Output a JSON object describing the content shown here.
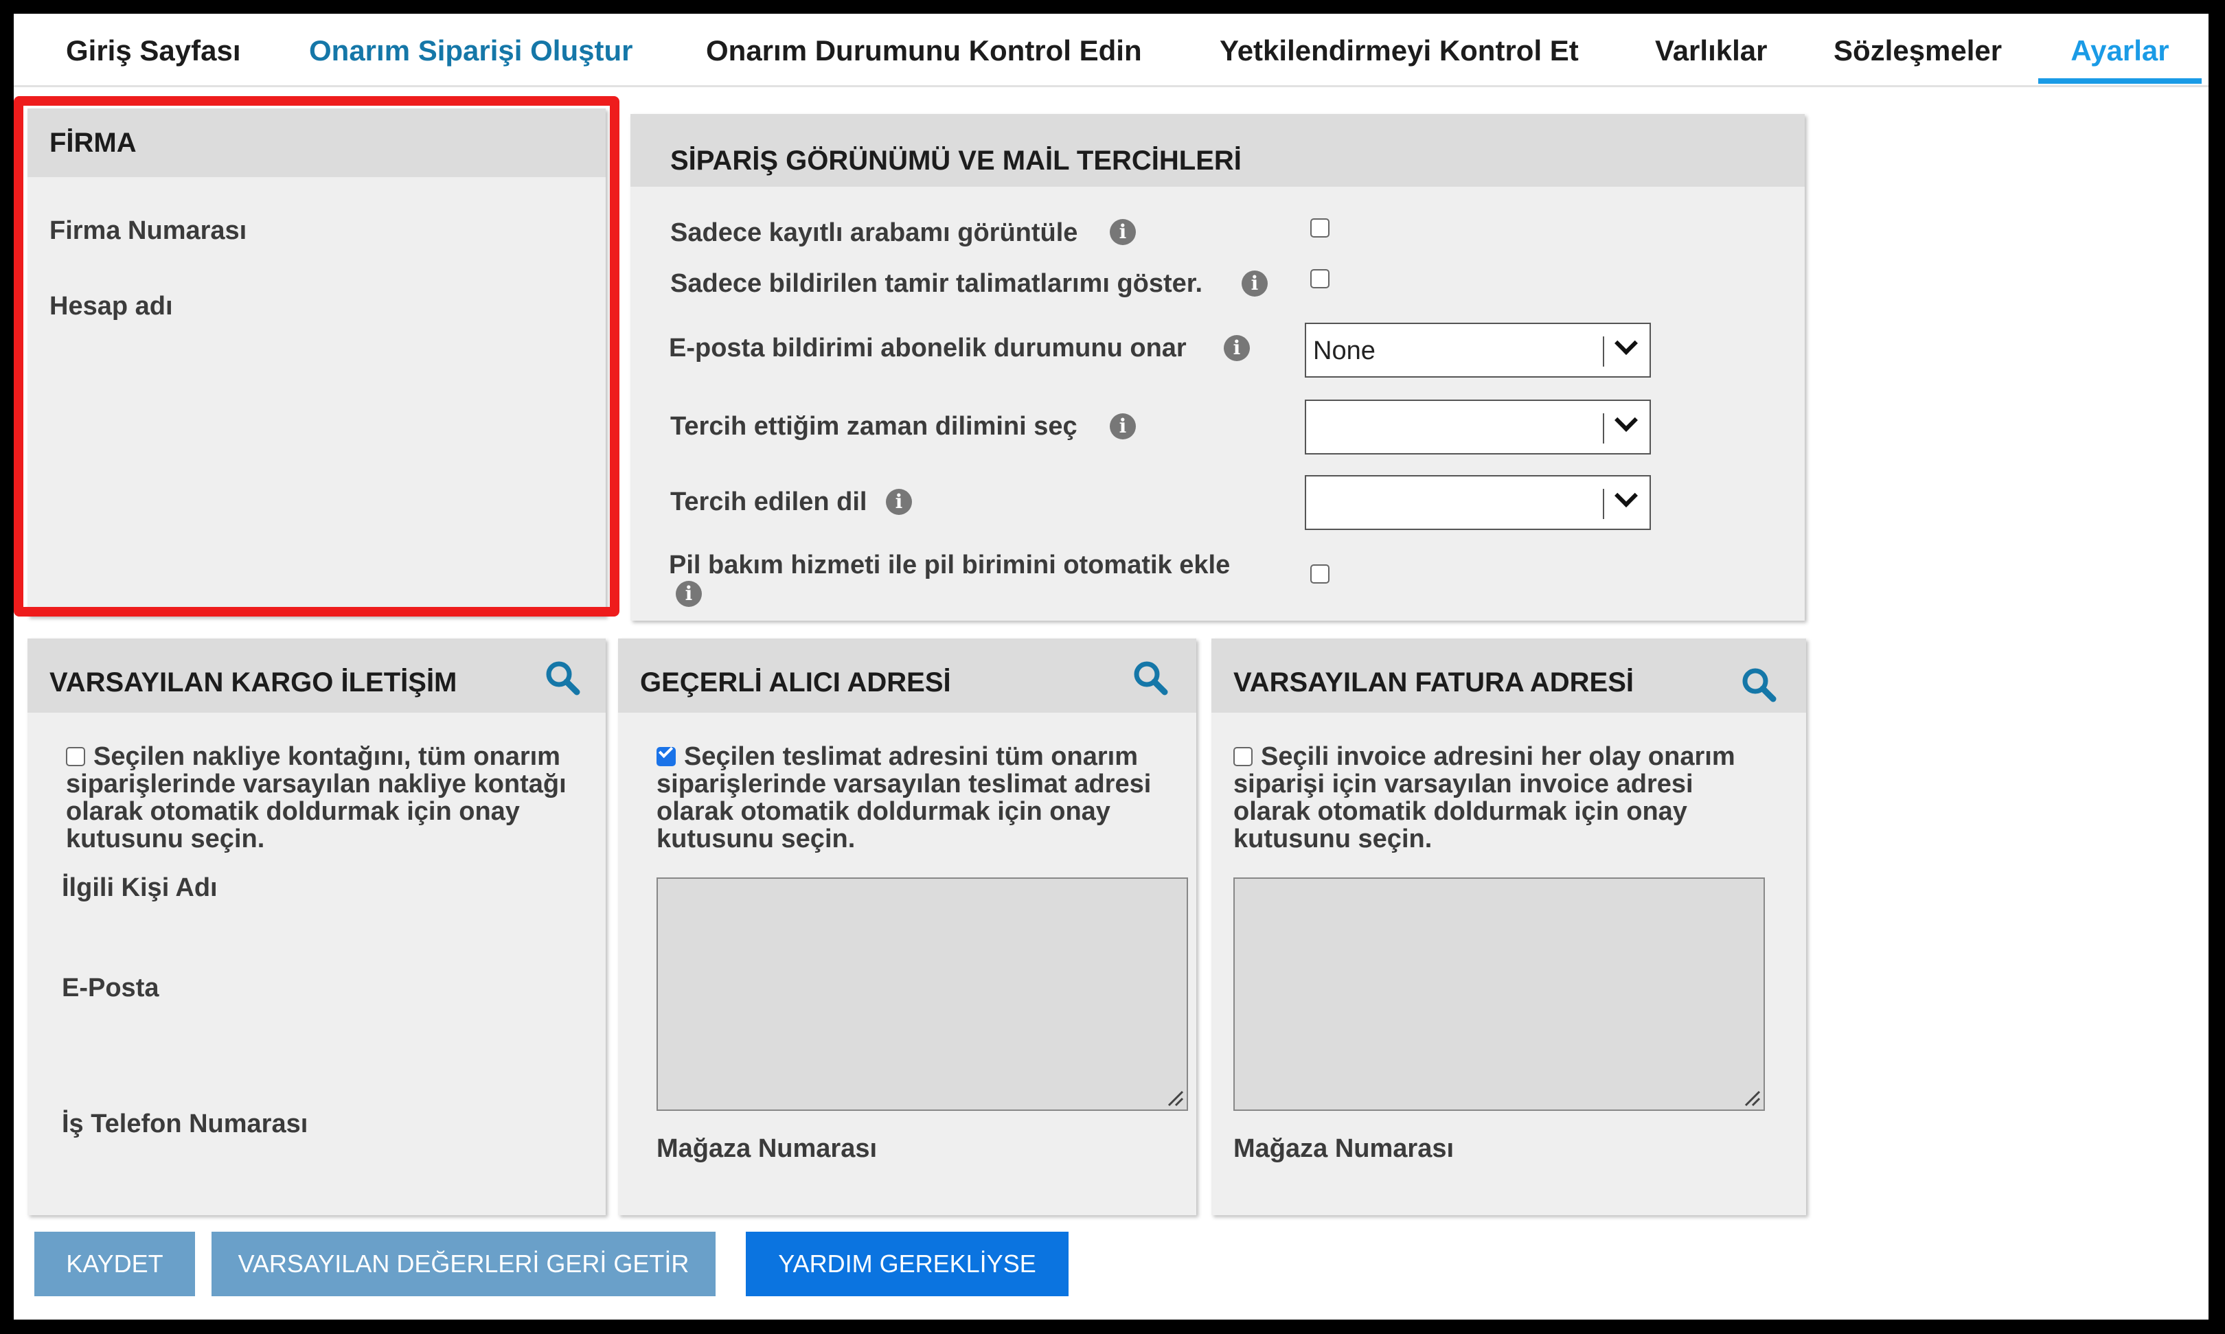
{
  "nav": {
    "tabs": [
      {
        "label": "Giriş Sayfası"
      },
      {
        "label": "Onarım Siparişi Oluştur"
      },
      {
        "label": "Onarım Durumunu Kontrol Edin"
      },
      {
        "label": "Yetkilendirmeyi Kontrol Et"
      },
      {
        "label": "Varlıklar"
      },
      {
        "label": "Sözleşmeler"
      },
      {
        "label": "Ayarlar"
      }
    ],
    "active": "Ayarlar"
  },
  "firma": {
    "title": "FİRMA",
    "fields": [
      "Firma Numarası",
      "Hesap adı"
    ]
  },
  "order": {
    "title": "SİPARİŞ GÖRÜNÜMÜ VE MAİL TERCİHLERİ",
    "opt1": "Sadece kayıtlı arabamı görüntüle",
    "opt2": "Sadece bildirilen tamir talimatlarımı göster.",
    "opt3": "E-posta bildirimi abonelik durumunu onar",
    "opt3_value": "None",
    "opt4": "Tercih ettiğim zaman dilimini seç",
    "opt4_value": "",
    "opt5": "Tercih edilen dil",
    "opt5_value": "",
    "opt6": "Pil bakım hizmeti ile pil birimini otomatik ekle"
  },
  "cargo": {
    "title": "VARSAYILAN KARGO İLETİŞİM",
    "desc": "Seçilen nakliye kontağını, tüm onarım siparişlerinde varsayılan nakliye kontağı olarak otomatik doldurmak için onay kutusunu seçin.",
    "fields": [
      "İlgili Kişi Adı",
      "E-Posta",
      "İş Telefon Numarası"
    ]
  },
  "receiver": {
    "title": "GEÇERLİ ALICI ADRESİ",
    "desc": "Seçilen teslimat adresini tüm onarım siparişlerinde varsayılan teslimat adresi olarak otomatik doldurmak için onay kutusunu seçin.",
    "store_label": "Mağaza Numarası"
  },
  "invoice": {
    "title": "VARSAYILAN FATURA ADRESİ",
    "desc": "Seçili invoice adresini her olay onarım siparişi için varsayılan invoice adresi olarak otomatik doldurmak için onay kutusunu seçin.",
    "store_label": "Mağaza Numarası"
  },
  "buttons": {
    "save": "KAYDET",
    "reset": "VARSAYILAN DEĞERLERİ GERİ GETİR",
    "help": "YARDIM GEREKLİYSE"
  },
  "colors": {
    "accent": "#1a9be6",
    "highlight": "#ee1c1c",
    "primary_button": "#0b74e0",
    "secondary_button": "#6aa0c9"
  }
}
